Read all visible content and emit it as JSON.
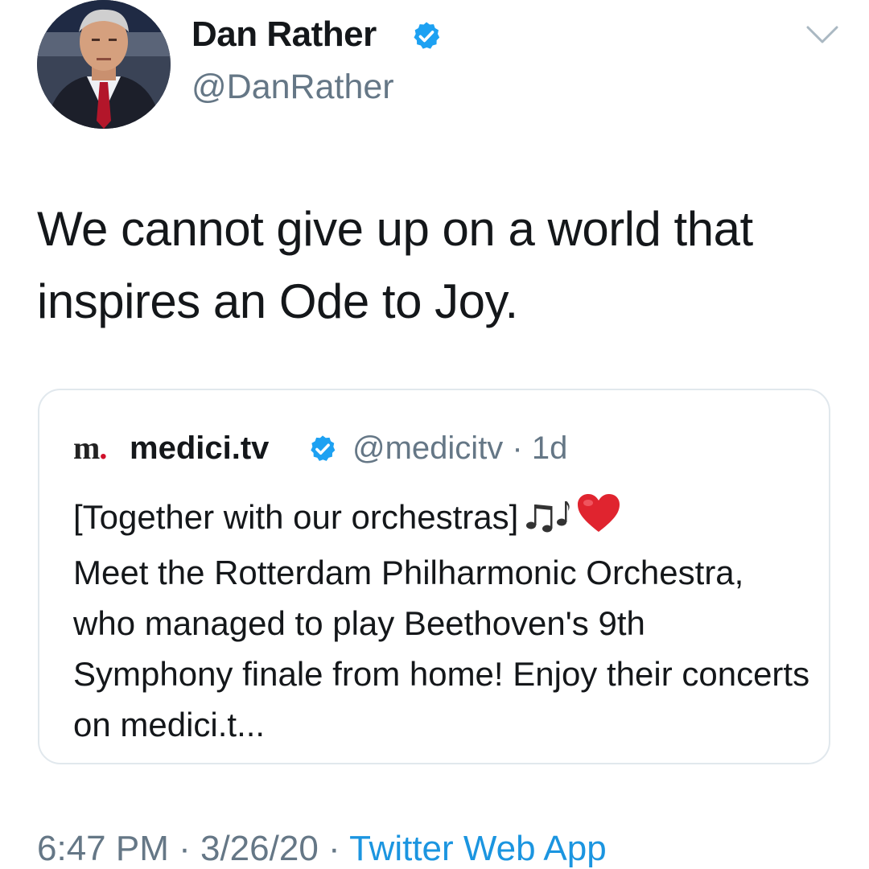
{
  "author": {
    "display_name": "Dan Rather",
    "handle": "@DanRather",
    "verified_icon": "verified-badge"
  },
  "tweet": {
    "text": "We cannot give up on a world that inspires an Ode to Joy."
  },
  "quoted": {
    "logo_letter": "m",
    "logo_dot": ".",
    "name": "medici.tv",
    "handle": "@medicitv",
    "separator": " · ",
    "time": "1d",
    "line1": "[Together with our orchestras]",
    "emojis": [
      "musical-notes-icon",
      "red-heart-icon"
    ],
    "line2": "Meet the Rotterdam Philharmonic Orchestra, who managed to play Beethoven's 9th Symphony finale from home! Enjoy their concerts on medici.t..."
  },
  "footer": {
    "time": "6:47 PM",
    "sep1": " · ",
    "date": "3/26/20",
    "sep2": " · ",
    "source": "Twitter Web App"
  },
  "colors": {
    "verified": "#1da1f2",
    "link": "#1b95e0",
    "secondary_text": "#657786",
    "border": "#e1e8ed",
    "heart": "#e0242f"
  }
}
